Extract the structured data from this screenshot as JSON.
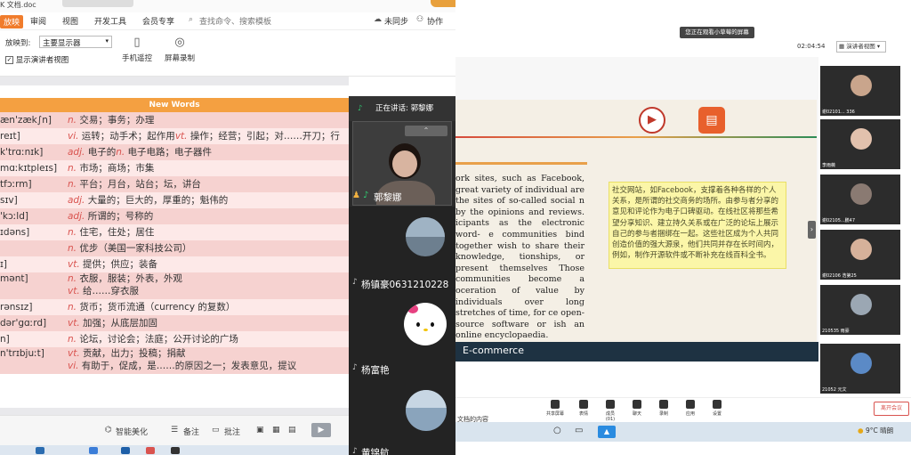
{
  "wps": {
    "doc_name": "K 文档.doc",
    "menu": {
      "active": "放映",
      "items": [
        "审阅",
        "视图",
        "开发工具",
        "会员专享"
      ],
      "search": "查找命令、搜索模板",
      "sync": "未同步",
      "collab": "协作"
    },
    "ribbon": {
      "play_to_label": "放映到:",
      "play_to_value": "主要显示器",
      "presenter_view": "显示演讲者视图",
      "remote": "手机遥控",
      "record": "屏幕录制"
    },
    "slide": {
      "header": "New Words",
      "rows": [
        {
          "ph": "æn'zæk∫n]",
          "pos": "n.",
          "text": " 交易；事务；办理"
        },
        {
          "ph": "reɪt]",
          "pos": "vi.",
          "text": " 运转；动手术；起作用",
          "pos2": "vt.",
          "text2": " 操作；经营；引起；对……开刀；行"
        },
        {
          "ph": "k'trɑːnɪk]",
          "pos": "adj.",
          "text": " 电子的",
          "pos2": "n.",
          "text2": " 电子电路；电子器件"
        },
        {
          "ph": "mɑːkɪtpleɪs]",
          "pos": "n.",
          "text": " 市场；商场；市集"
        },
        {
          "ph": "tfɔːrm]",
          "pos": "n.",
          "text": " 平台；月台，站台；坛，讲台"
        },
        {
          "ph": "sɪv]",
          "pos": "adj.",
          "text": " 大量的；巨大的，厚重的；魁伟的"
        },
        {
          "ph": "'kɔːld]",
          "pos": "adj.",
          "text": " 所谓的；号称的"
        },
        {
          "ph": "ɪdəns]",
          "pos": "n.",
          "text": " 住宅，住处；居住"
        },
        {
          "ph": "",
          "pos": "n.",
          "text": " 优步（美国一家科技公司）"
        },
        {
          "ph": "ɪ]",
          "pos": "vt.",
          "text": " 提供；供应；装备"
        },
        {
          "ph": "mənt]",
          "pos": "n.",
          "text": " 衣服，服装；外表，外观",
          "line2_pos": "vt.",
          "line2": " 给……穿衣服"
        },
        {
          "ph": "rənsɪz]",
          "pos": "n.",
          "text": " 货币；货币流通（currency 的复数）"
        },
        {
          "ph": "dər'gɑːrd]",
          "pos": "vt.",
          "text": " 加强；从底层加固"
        },
        {
          "ph": "n]",
          "pos": "n.",
          "text": " 论坛，讨论会；法庭；公开讨论的广场"
        },
        {
          "ph": "n'trɪbjuːt]",
          "pos": "vt.",
          "text": " 贡献，出力；投稿；捐献",
          "line2_pos": "vi.",
          "line2": " 有助于，促成，是……的原因之一；发表意见，提议"
        }
      ]
    },
    "status": {
      "beautify": "智能美化",
      "notes": "备注",
      "comments": "批注"
    }
  },
  "participants": {
    "speaking": "正在讲话: 郭黎娜",
    "speaker_name": "郭黎娜",
    "names": [
      "杨镇豪0631210228",
      "杨富艳",
      "黄锦航"
    ]
  },
  "meeting": {
    "share_tip": "您正在观看小草莓的屏幕",
    "timer": "02:04:54",
    "view": "演讲者视图",
    "slide_english": "ork sites, such as Facebook, great variety of individual are the sites of so-called social n by the opinions and reviews. icipants as the electronic word- e communities bind together wish to share their knowledge, tionships, or present themselves Those communities become a oceration of value by individuals over long stretches of time, for ce open-source software or ish an online encyclopaedia.",
    "slide_chinese": "社交网站，如Facebook，支撑着各种各样的个人关系，是所谓的社交商务的场所。由参与者分享的意见和评论作为电子口碑驱动。在线社区将那些希望分享知识、建立持久关系或在广泛的论坛上展示自己的参与者捆绑在一起。这些社区成为个人共同创造价值的强大源泉，他们共同并存在长时间内，例如，制作开源软件或不断补充在线百科全书。",
    "section": "E-commerce",
    "tiles": [
      "谢02101... 336",
      "李雨薇",
      "谢02105...鹏47",
      "谢02106 浩第25",
      "210535 雨豪",
      "21052 元文"
    ],
    "toolbar": [
      "共享屏幕",
      "表情",
      "成员(01)",
      "聊天",
      "录制",
      "应用",
      "设置"
    ],
    "end_btn": "离开会议",
    "bottom_text": "文档的内容",
    "weather": "9°C 晴朗"
  },
  "colors": {
    "accent_orange": "#f07c2c",
    "row_pink": "#f6d2d0",
    "chinese_box": "#fbf6a8",
    "ecom_bar": "#1e3242"
  }
}
